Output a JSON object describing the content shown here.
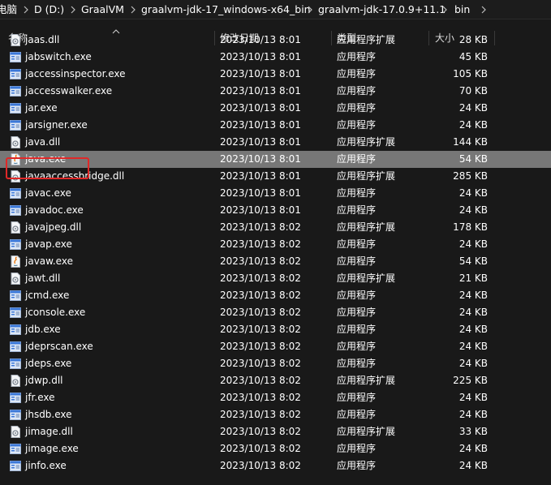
{
  "breadcrumb": [
    "电脑",
    "D (D:)",
    "GraalVM",
    "graalvm-jdk-17_windows-x64_bin",
    "graalvm-jdk-17.0.9+11.1",
    "bin"
  ],
  "columns": {
    "name": "名称",
    "modified": "修改日期",
    "type": "类型",
    "size": "大小"
  },
  "colors": {
    "background": "#191919",
    "selected_row": "#777777",
    "highlight_border": "#e02828"
  },
  "selected_file": "java.exe",
  "files": [
    {
      "name": "jaas.dll",
      "modified": "2023/10/13 8:01",
      "type": "应用程序扩展",
      "size": "28 KB",
      "icon": "dll-file-icon"
    },
    {
      "name": "jabswitch.exe",
      "modified": "2023/10/13 8:01",
      "type": "应用程序",
      "size": "45 KB",
      "icon": "exe-file-icon"
    },
    {
      "name": "jaccessinspector.exe",
      "modified": "2023/10/13 8:01",
      "type": "应用程序",
      "size": "105 KB",
      "icon": "exe-file-icon"
    },
    {
      "name": "jaccesswalker.exe",
      "modified": "2023/10/13 8:01",
      "type": "应用程序",
      "size": "70 KB",
      "icon": "exe-file-icon"
    },
    {
      "name": "jar.exe",
      "modified": "2023/10/13 8:01",
      "type": "应用程序",
      "size": "24 KB",
      "icon": "exe-file-icon"
    },
    {
      "name": "jarsigner.exe",
      "modified": "2023/10/13 8:01",
      "type": "应用程序",
      "size": "24 KB",
      "icon": "exe-file-icon"
    },
    {
      "name": "java.dll",
      "modified": "2023/10/13 8:01",
      "type": "应用程序扩展",
      "size": "144 KB",
      "icon": "dll-file-icon"
    },
    {
      "name": "java.exe",
      "modified": "2023/10/13 8:01",
      "type": "应用程序",
      "size": "54 KB",
      "icon": "java-exe-icon"
    },
    {
      "name": "javaaccessbridge.dll",
      "modified": "2023/10/13 8:01",
      "type": "应用程序扩展",
      "size": "285 KB",
      "icon": "dll-file-icon"
    },
    {
      "name": "javac.exe",
      "modified": "2023/10/13 8:01",
      "type": "应用程序",
      "size": "24 KB",
      "icon": "exe-file-icon"
    },
    {
      "name": "javadoc.exe",
      "modified": "2023/10/13 8:01",
      "type": "应用程序",
      "size": "24 KB",
      "icon": "exe-file-icon"
    },
    {
      "name": "javajpeg.dll",
      "modified": "2023/10/13 8:02",
      "type": "应用程序扩展",
      "size": "178 KB",
      "icon": "dll-file-icon"
    },
    {
      "name": "javap.exe",
      "modified": "2023/10/13 8:02",
      "type": "应用程序",
      "size": "24 KB",
      "icon": "exe-file-icon"
    },
    {
      "name": "javaw.exe",
      "modified": "2023/10/13 8:02",
      "type": "应用程序",
      "size": "54 KB",
      "icon": "java-exe-icon"
    },
    {
      "name": "jawt.dll",
      "modified": "2023/10/13 8:02",
      "type": "应用程序扩展",
      "size": "21 KB",
      "icon": "dll-file-icon"
    },
    {
      "name": "jcmd.exe",
      "modified": "2023/10/13 8:02",
      "type": "应用程序",
      "size": "24 KB",
      "icon": "exe-file-icon"
    },
    {
      "name": "jconsole.exe",
      "modified": "2023/10/13 8:02",
      "type": "应用程序",
      "size": "24 KB",
      "icon": "exe-file-icon"
    },
    {
      "name": "jdb.exe",
      "modified": "2023/10/13 8:02",
      "type": "应用程序",
      "size": "24 KB",
      "icon": "exe-file-icon"
    },
    {
      "name": "jdeprscan.exe",
      "modified": "2023/10/13 8:02",
      "type": "应用程序",
      "size": "24 KB",
      "icon": "exe-file-icon"
    },
    {
      "name": "jdeps.exe",
      "modified": "2023/10/13 8:02",
      "type": "应用程序",
      "size": "24 KB",
      "icon": "exe-file-icon"
    },
    {
      "name": "jdwp.dll",
      "modified": "2023/10/13 8:02",
      "type": "应用程序扩展",
      "size": "225 KB",
      "icon": "dll-file-icon"
    },
    {
      "name": "jfr.exe",
      "modified": "2023/10/13 8:02",
      "type": "应用程序",
      "size": "24 KB",
      "icon": "exe-file-icon"
    },
    {
      "name": "jhsdb.exe",
      "modified": "2023/10/13 8:02",
      "type": "应用程序",
      "size": "24 KB",
      "icon": "exe-file-icon"
    },
    {
      "name": "jimage.dll",
      "modified": "2023/10/13 8:02",
      "type": "应用程序扩展",
      "size": "33 KB",
      "icon": "dll-file-icon"
    },
    {
      "name": "jimage.exe",
      "modified": "2023/10/13 8:02",
      "type": "应用程序",
      "size": "24 KB",
      "icon": "exe-file-icon"
    },
    {
      "name": "jinfo.exe",
      "modified": "2023/10/13 8:02",
      "type": "应用程序",
      "size": "24 KB",
      "icon": "exe-file-icon"
    }
  ]
}
